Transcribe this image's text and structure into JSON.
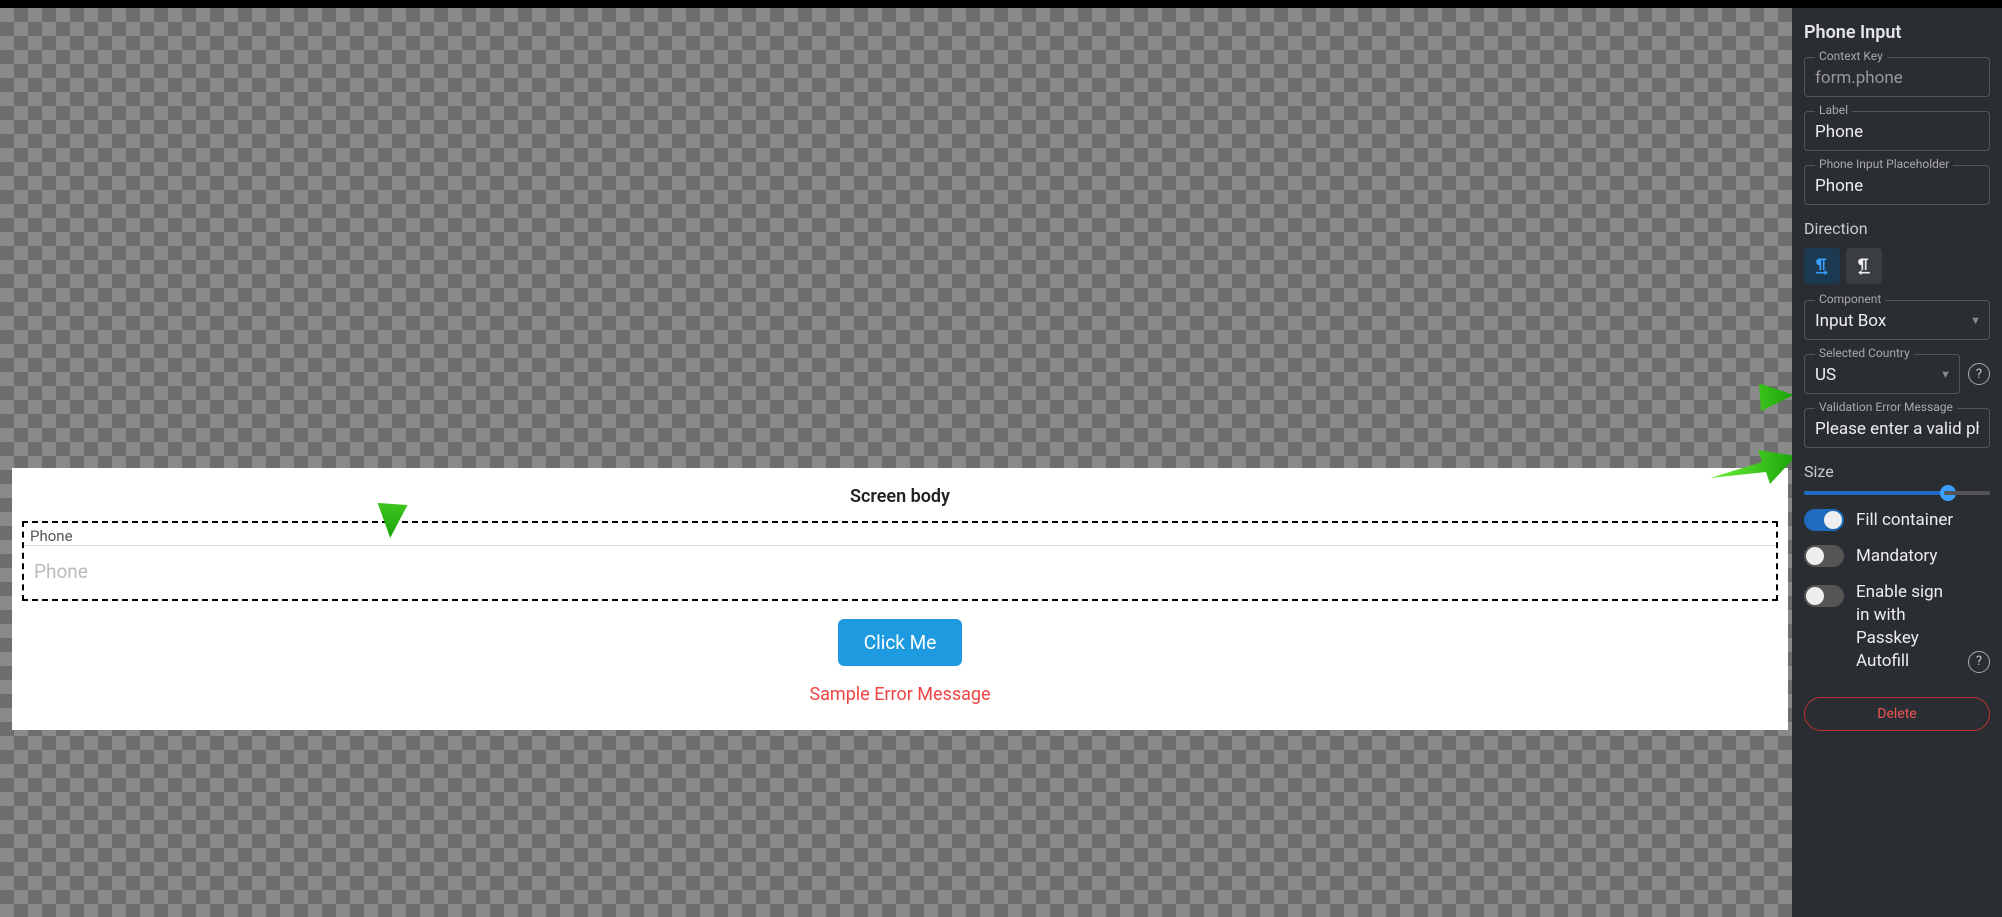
{
  "preview": {
    "title": "Screen body",
    "phone_label": "Phone",
    "phone_placeholder": "Phone",
    "button_label": "Click Me",
    "error_message": "Sample Error Message"
  },
  "panel": {
    "title": "Phone Input",
    "context_key": {
      "label": "Context Key",
      "value": "form.phone"
    },
    "label_field": {
      "label": "Label",
      "value": "Phone"
    },
    "placeholder_field": {
      "label": "Phone Input Placeholder",
      "value": "Phone"
    },
    "direction": {
      "label": "Direction",
      "selected": "ltr"
    },
    "component": {
      "label": "Component",
      "value": "Input Box"
    },
    "selected_country": {
      "label": "Selected Country",
      "value": "US"
    },
    "validation_error": {
      "label": "Validation Error Message",
      "value": "Please enter a valid phone"
    },
    "size": {
      "label": "Size",
      "value_pct": 73
    },
    "fill_container": {
      "label": "Fill container",
      "value": true
    },
    "mandatory": {
      "label": "Mandatory",
      "value": false
    },
    "passkey": {
      "label": "Enable sign in with Passkey Autofill",
      "value": false
    },
    "delete_label": "Delete"
  },
  "colors": {
    "accent": "#1e9ae0",
    "panel_bg": "#2a2d31",
    "error": "#e44",
    "annotation": "#3bd12a"
  }
}
